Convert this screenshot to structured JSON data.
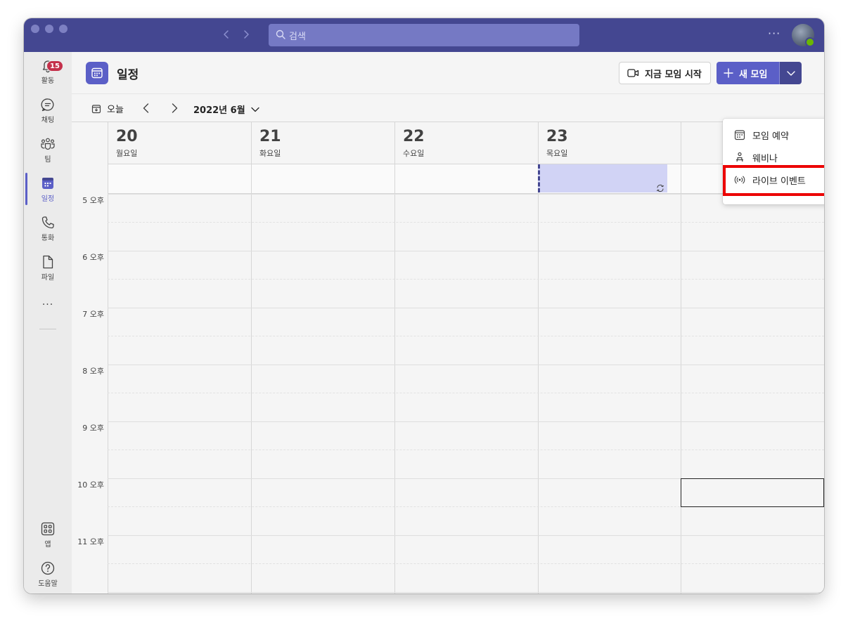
{
  "titlebar": {
    "search_placeholder": "검색",
    "more_label": "···"
  },
  "rail": {
    "items": [
      {
        "label": "활동",
        "icon": "bell-icon",
        "badge": "15"
      },
      {
        "label": "채팅",
        "icon": "chat-icon"
      },
      {
        "label": "팀",
        "icon": "teams-icon"
      },
      {
        "label": "일정",
        "icon": "calendar-icon",
        "active": true
      },
      {
        "label": "통화",
        "icon": "phone-icon"
      },
      {
        "label": "파일",
        "icon": "file-icon"
      }
    ],
    "more_label": "···",
    "bottom_items": [
      {
        "label": "앱",
        "icon": "apps-icon"
      },
      {
        "label": "도움말",
        "icon": "help-icon"
      }
    ]
  },
  "header": {
    "title": "일정",
    "meet_now_label": "지금 모임 시작",
    "new_meeting_label": "새 모임"
  },
  "toolbar": {
    "today_label": "오늘",
    "month_label": "2022년 6월"
  },
  "days": [
    {
      "num": "20",
      "name": "월요일"
    },
    {
      "num": "21",
      "name": "화요일"
    },
    {
      "num": "22",
      "name": "수요일"
    },
    {
      "num": "23",
      "name": "목요일"
    }
  ],
  "times": [
    "5 오후",
    "6 오후",
    "7 오후",
    "8 오후",
    "9 오후",
    "10 오후",
    "11 오후"
  ],
  "menu": {
    "items": [
      {
        "label": "모임 예약",
        "icon": "calendar-schedule-icon"
      },
      {
        "label": "웨비나",
        "icon": "webinar-icon"
      },
      {
        "label": "라이브 이벤트",
        "icon": "live-event-icon"
      }
    ]
  },
  "colors": {
    "titlebar": "#444791",
    "accent": "#5b5fc7",
    "badge": "#c4314b",
    "highlight": "#ec0000",
    "event": "#d1d3f5"
  }
}
